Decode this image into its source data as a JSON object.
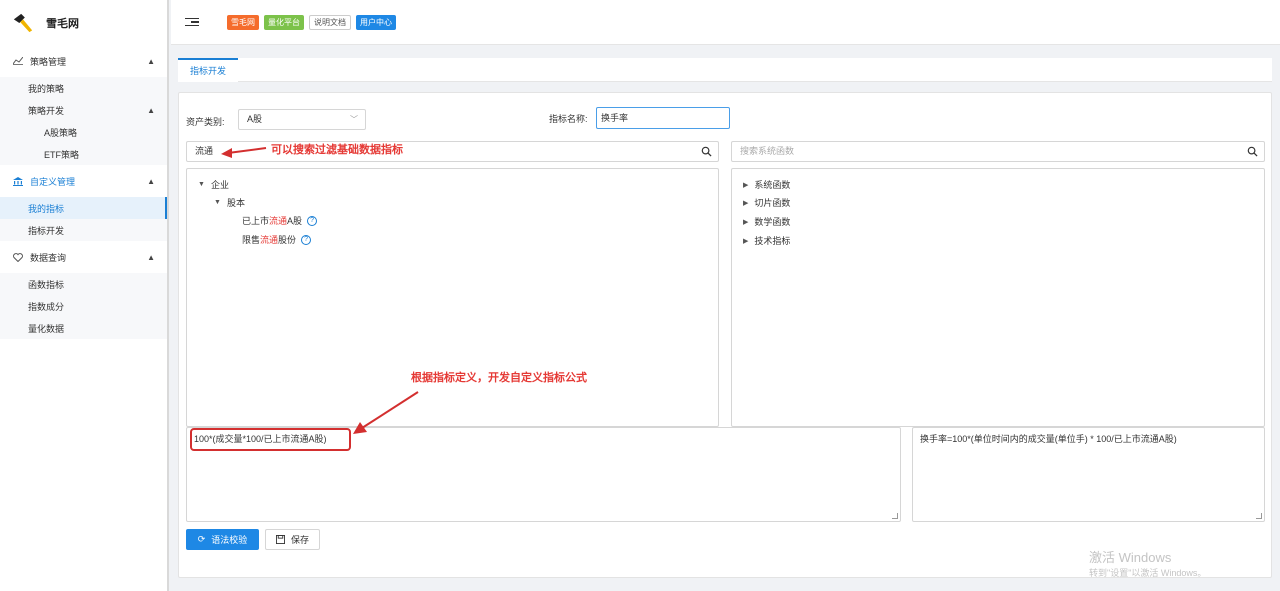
{
  "app": {
    "title": "雪毛网"
  },
  "topbar": {
    "tags": [
      {
        "label": "雪毛网",
        "color": "#f56c2c"
      },
      {
        "label": "量化平台",
        "color": "#7cc24a"
      },
      {
        "label": "说明文档",
        "color": "#ffffff"
      },
      {
        "label": "用户中心",
        "color": "#1e88e5"
      }
    ]
  },
  "sidebar": {
    "strategy": {
      "label": "策略管理",
      "items": {
        "mine": "我的策略",
        "dev": "策略开发",
        "a_share": "A股策略",
        "etf": "ETF策略"
      }
    },
    "custom": {
      "label": "自定义管理",
      "items": {
        "my_index": "我的指标",
        "index_dev": "指标开发"
      }
    },
    "data": {
      "label": "数据查询",
      "items": {
        "func": "函数指标",
        "components": "指数成分",
        "quant": "量化数据"
      }
    }
  },
  "tab": {
    "label": "指标开发"
  },
  "form": {
    "asset_type_label": "资产类别:",
    "asset_type_value": "A股",
    "index_name_label": "指标名称:",
    "index_name_value": "换手率"
  },
  "left_search": {
    "value": "流通"
  },
  "right_search": {
    "placeholder": "搜索系统函数"
  },
  "left_tree": {
    "root": "企业",
    "child": "股本",
    "leaf1": {
      "pre": "已上市",
      "hl": "流通",
      "post": "A股"
    },
    "leaf2": {
      "pre": "限售",
      "hl": "流通",
      "post": "股份"
    }
  },
  "right_tree": [
    "系统函数",
    "切片函数",
    "数学函数",
    "技术指标"
  ],
  "formula": {
    "value": "100*(成交量*100/已上市流通A股)"
  },
  "description": {
    "value": "换手率=100*(单位时间内的成交量(单位手) * 100/已上市流通A股)"
  },
  "buttons": {
    "validate": "语法校验",
    "save": "保存"
  },
  "annotations": {
    "search_hint": "可以搜索过滤基础数据指标",
    "formula_hint": "根据指标定义，开发自定义指标公式"
  },
  "watermark": {
    "line1": "激活 Windows",
    "line2": "转到\"设置\"以激活 Windows。"
  },
  "colors": {
    "accent": "#1e88e5",
    "highlight": "#e53935",
    "annotation": "#d32f2f"
  }
}
